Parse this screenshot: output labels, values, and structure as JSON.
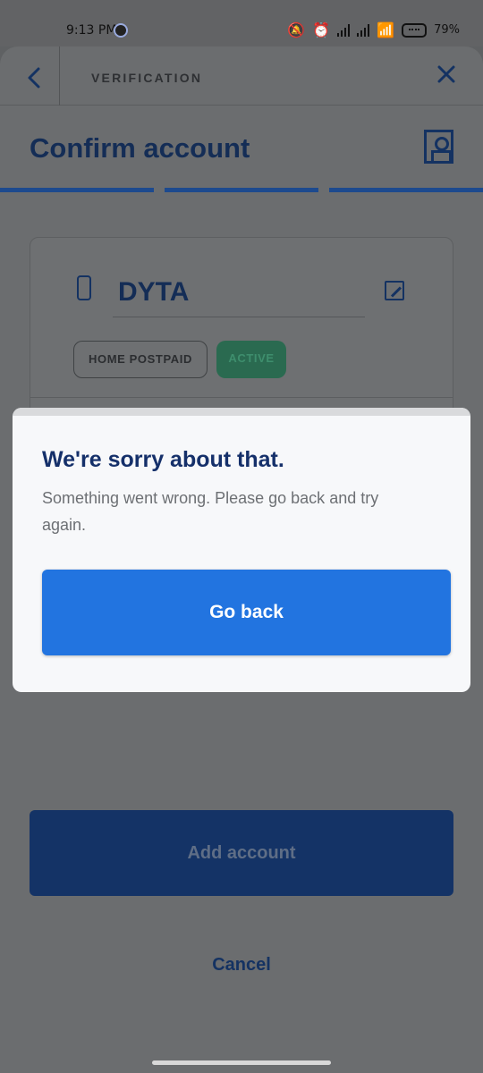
{
  "status_bar": {
    "time": "9:13 PM",
    "battery": "79"
  },
  "header": {
    "title": "VERIFICATION",
    "back_icon": "chevron-left-icon",
    "close_icon": "close-icon"
  },
  "page": {
    "title": "Confirm account",
    "progress_segments": 3,
    "progress_completed": 3
  },
  "account": {
    "name": "DYTA",
    "plan_badge": "HOME POSTPAID",
    "status_badge": "ACTIVE"
  },
  "actions": {
    "add_account": "Add account",
    "cancel": "Cancel"
  },
  "modal": {
    "title": "We're sorry about that.",
    "message": "Something went wrong. Please go back and try again.",
    "button": "Go back"
  },
  "colors": {
    "primary_button": "#2274e0",
    "title_navy": "#15306a",
    "status_active": "#2a6a50"
  }
}
